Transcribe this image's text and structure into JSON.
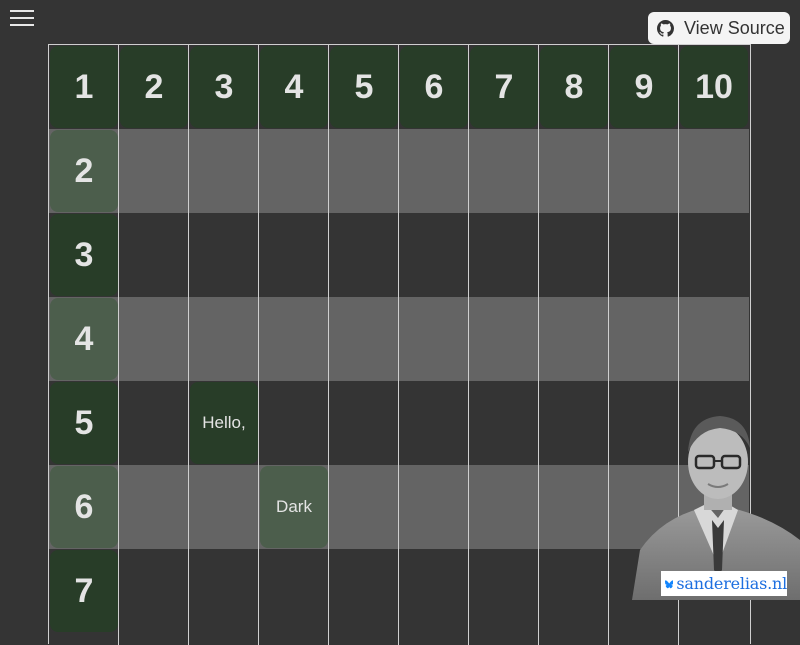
{
  "menu": {
    "icon": "hamburger-menu-icon"
  },
  "view_source": {
    "label": "View Source",
    "icon": "github-icon"
  },
  "grid": {
    "column_headers": [
      "1",
      "2",
      "3",
      "4",
      "5",
      "6",
      "7",
      "8",
      "9",
      "10"
    ],
    "row_headers": [
      "2",
      "3",
      "4",
      "5",
      "6",
      "7"
    ],
    "messages": [
      {
        "row": 5,
        "col": 3,
        "text": "Hello,"
      },
      {
        "row": 6,
        "col": 4,
        "text": "Dark"
      }
    ]
  },
  "badge": {
    "icon": "butterfly-icon",
    "text": "sanderelias.nl"
  },
  "colors": {
    "background": "#343434",
    "stripe": "#646464",
    "cell_dark_green": "#283d28",
    "cell_light_green": "#4c5e4c",
    "badge_link": "#1d6fe0"
  }
}
